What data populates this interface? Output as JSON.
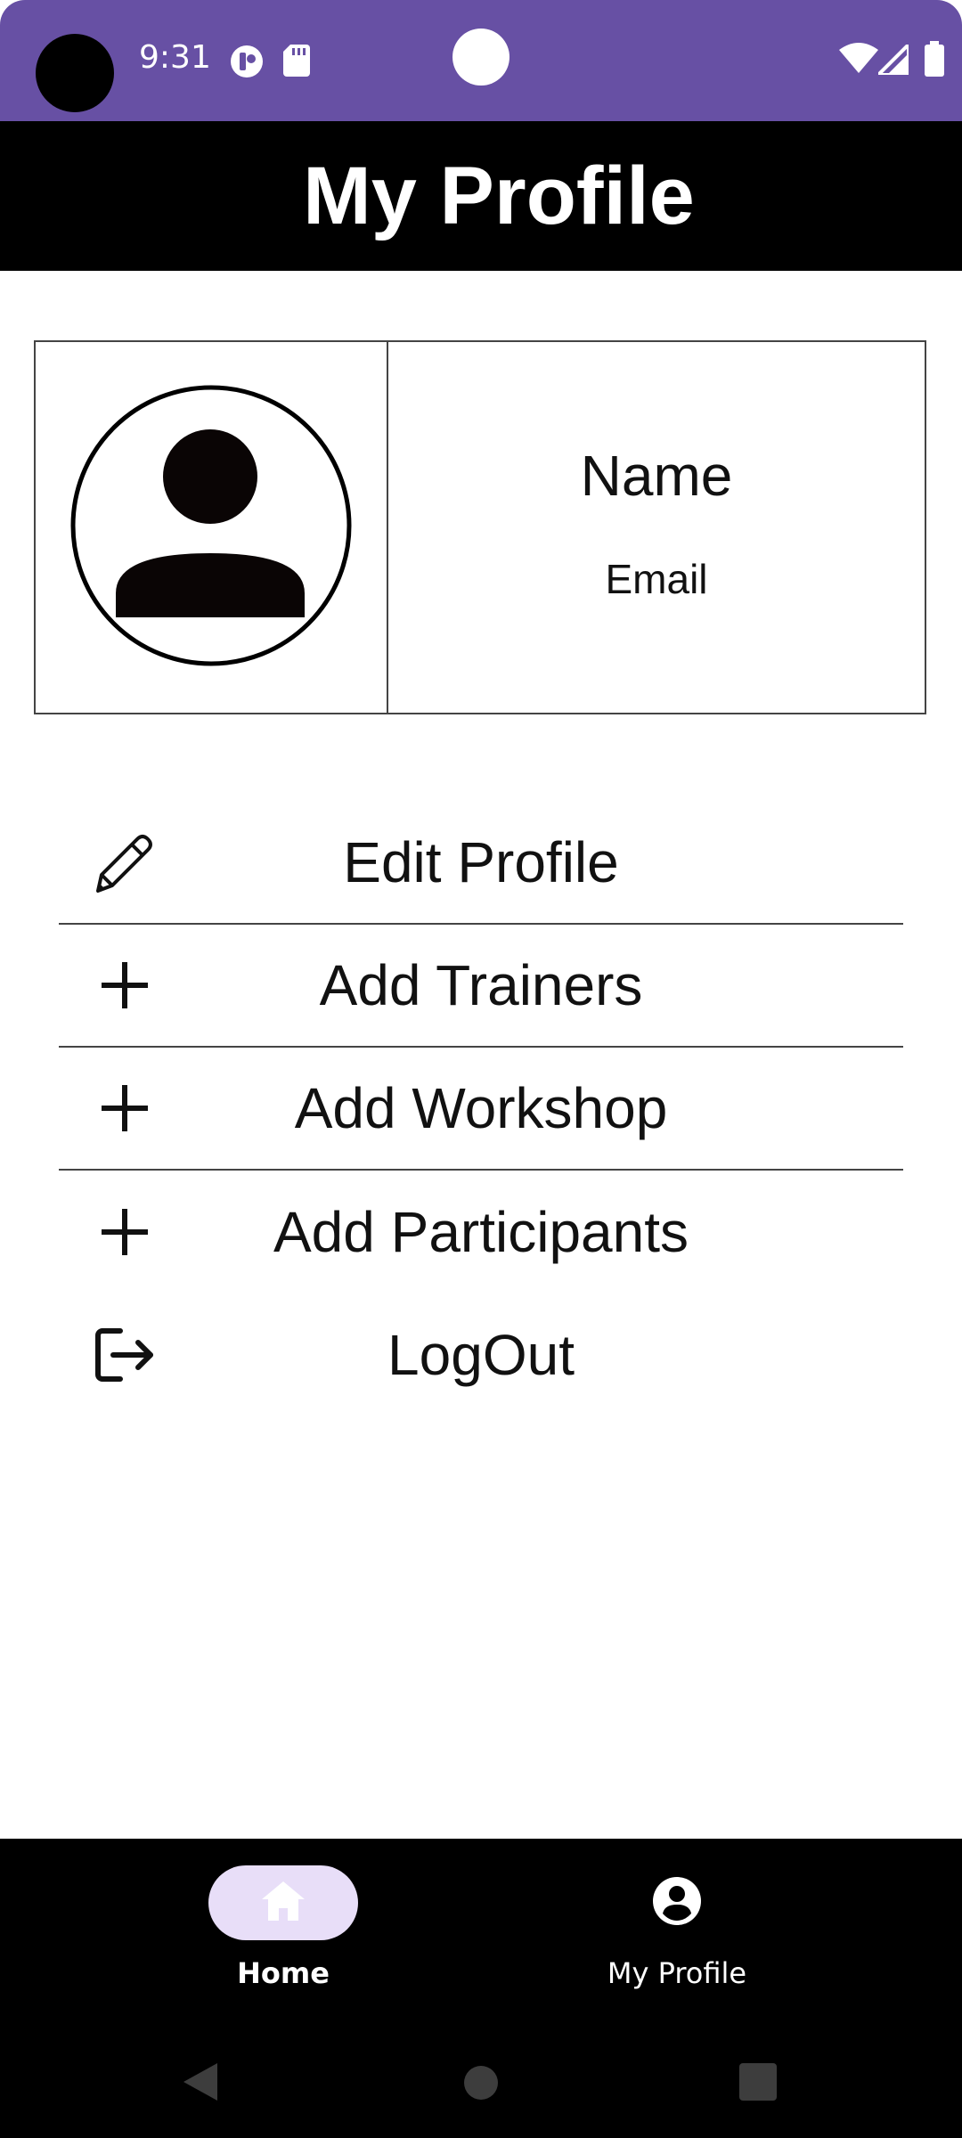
{
  "status_bar": {
    "time": "9:31",
    "icons": [
      "notification-app-icon",
      "sd-card-icon",
      "wifi-icon",
      "cellular-signal-icon",
      "battery-icon"
    ],
    "color": "#6750A4"
  },
  "header": {
    "title": "My Profile"
  },
  "profile": {
    "name": "Name",
    "email": "Email",
    "avatar_icon": "account-circle-icon"
  },
  "menu": {
    "items": [
      {
        "label": "Edit Profile",
        "icon": "pencil-icon"
      },
      {
        "label": "Add Trainers",
        "icon": "plus-icon"
      },
      {
        "label": "Add Workshop",
        "icon": "plus-icon"
      },
      {
        "label": "Add Participants",
        "icon": "plus-icon"
      },
      {
        "label": "LogOut",
        "icon": "logout-icon"
      }
    ]
  },
  "bottom_nav": {
    "items": [
      {
        "label": "Home",
        "icon": "home-icon",
        "active": true
      },
      {
        "label": "My Profile",
        "icon": "account-circle-icon",
        "active": false
      }
    ],
    "active_pill_color": "#E8DEF8"
  },
  "system_nav": {
    "icons": [
      "back-icon",
      "home-circle-icon",
      "recents-icon"
    ]
  }
}
